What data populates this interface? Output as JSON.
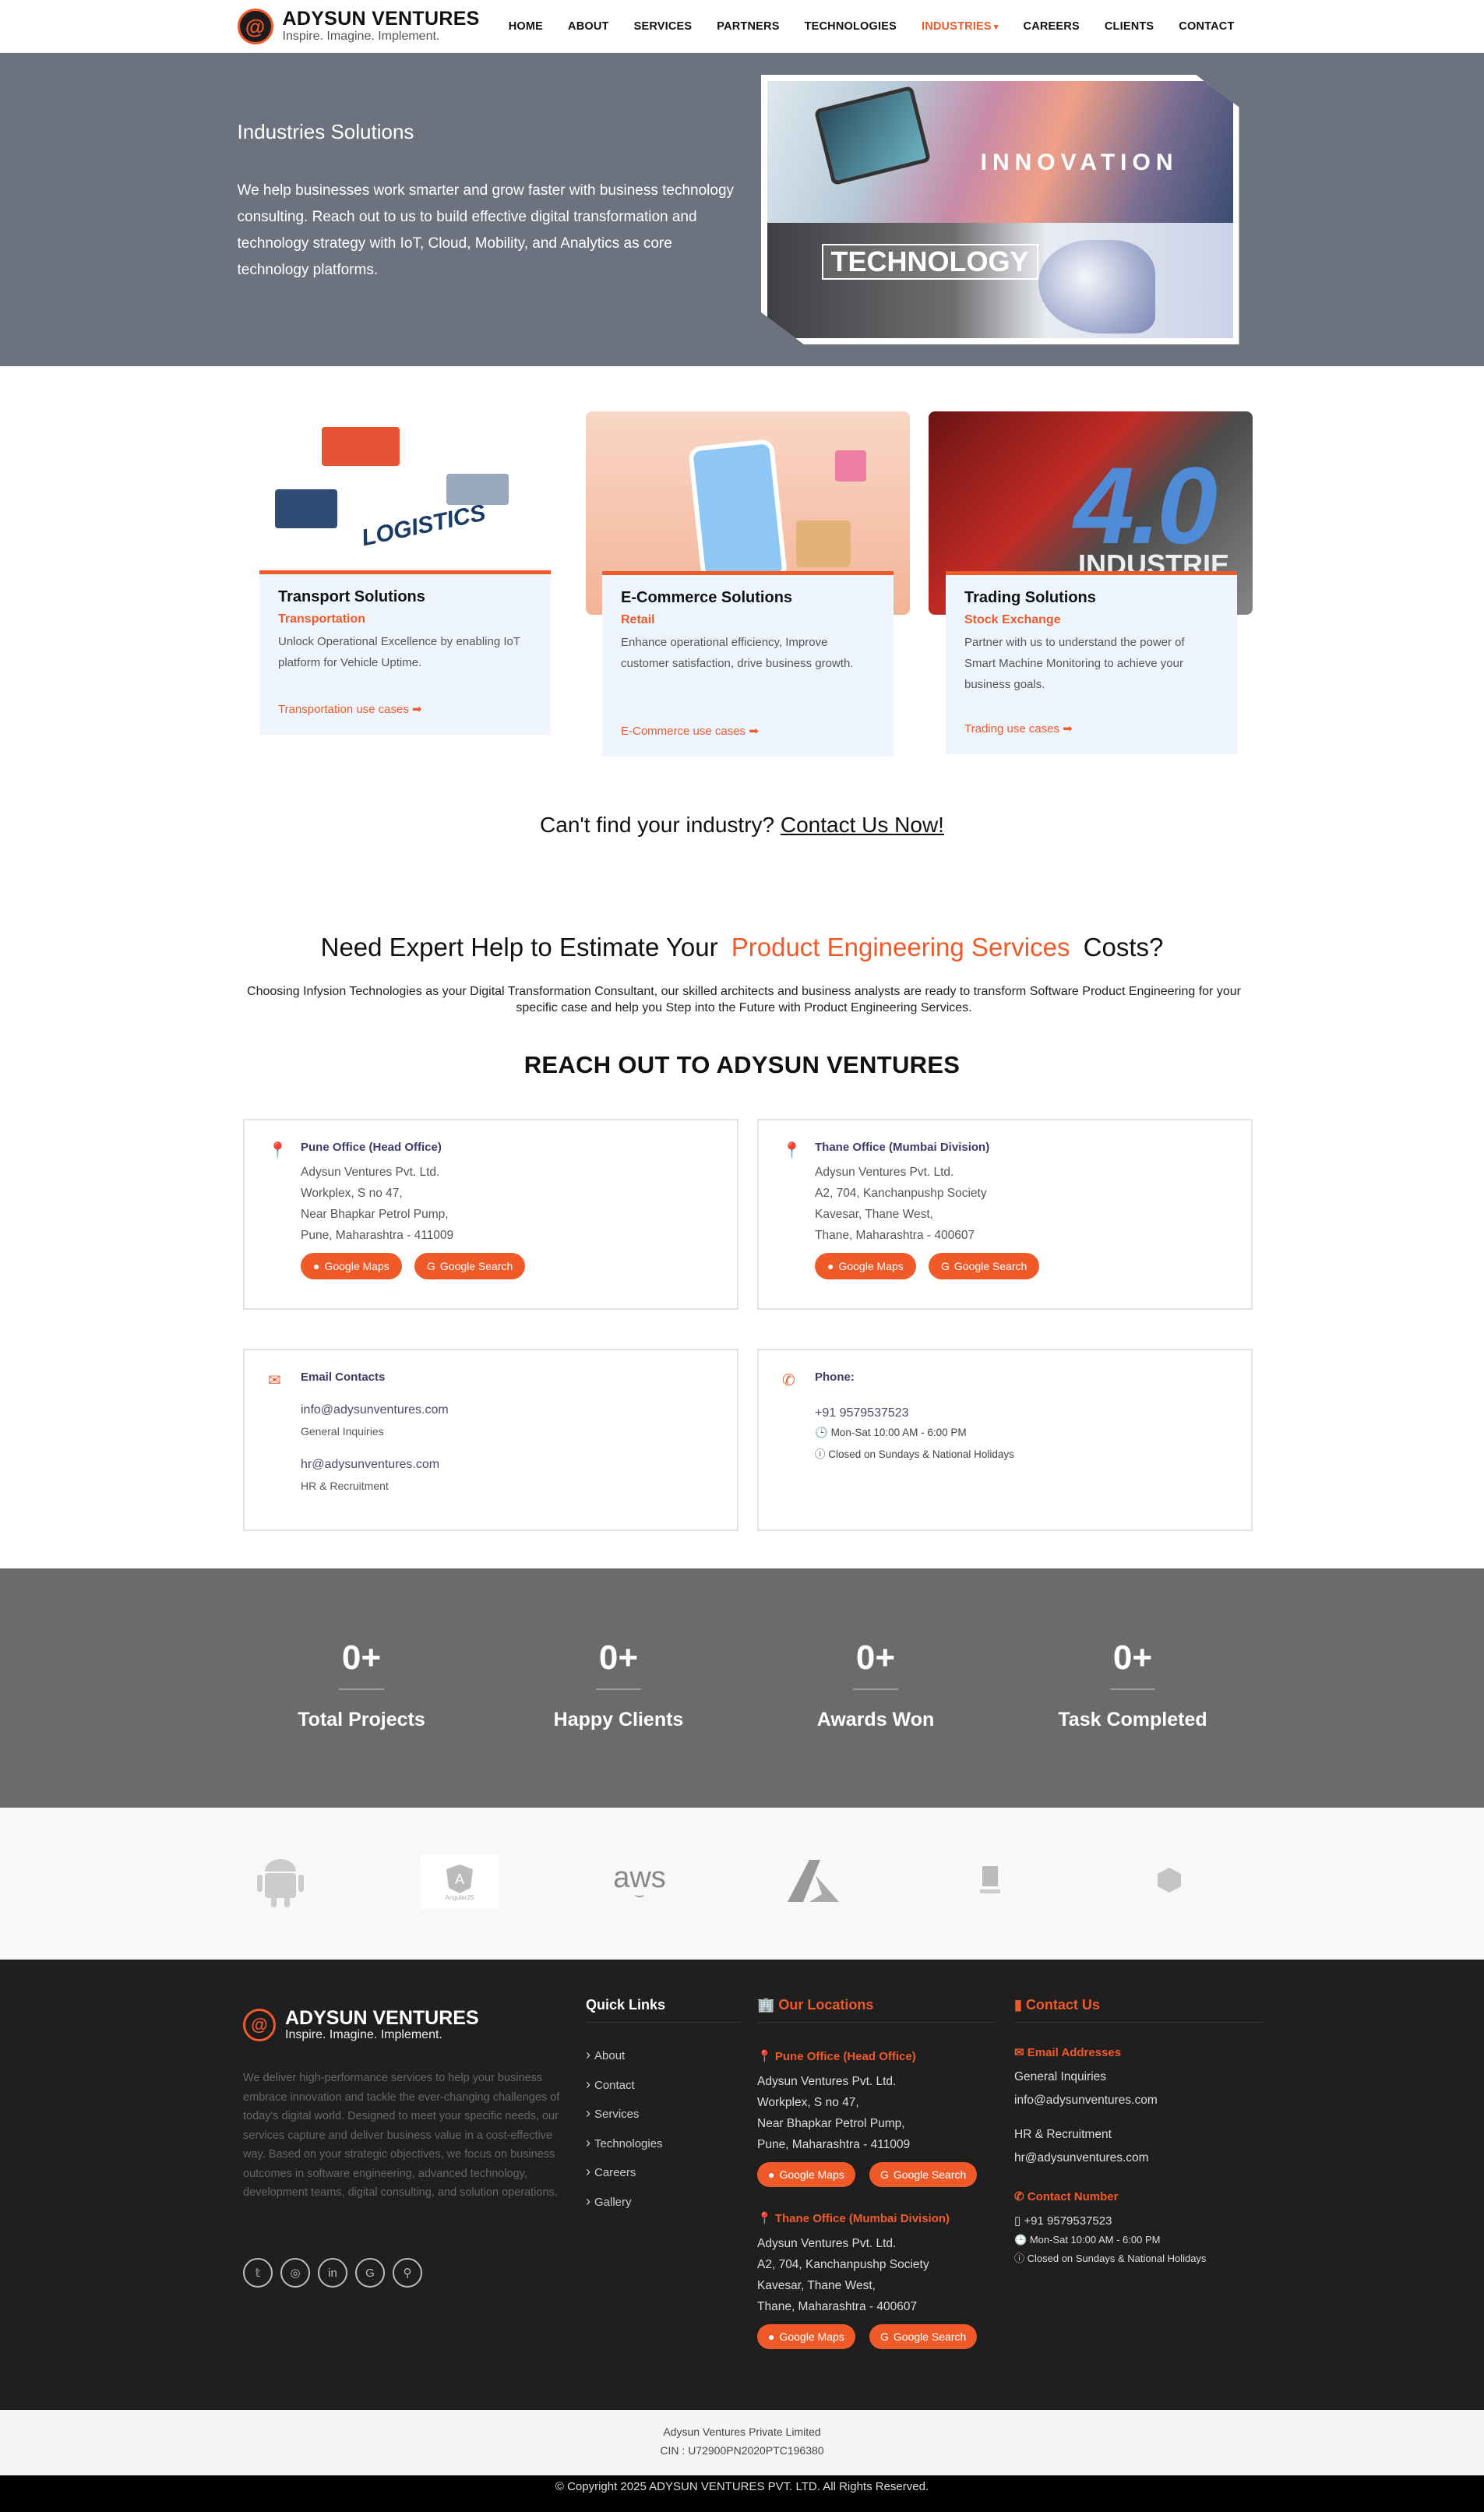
{
  "header": {
    "brand_name": "ADYSUN VENTURES",
    "tagline": "Inspire. Imagine. Implement.",
    "logo_icon": "@",
    "nav": [
      "HOME",
      "ABOUT",
      "SERVICES",
      "PARTNERS",
      "TECHNOLOGIES",
      "INDUSTRIES",
      "CAREERS",
      "CLIENTS",
      "CONTACT"
    ],
    "active_nav": "INDUSTRIES"
  },
  "hero": {
    "title": "Industries Solutions",
    "text": "We help businesses work smarter and grow faster with business technology consulting. Reach out to us to build effective digital transformation and technology strategy with IoT, Cloud, Mobility, and Analytics as core technology platforms.",
    "img_word_1": "INNOVATION",
    "img_word_2": "TECHNOLOGY"
  },
  "industries": [
    {
      "title": "Transport Solutions",
      "sub": "Transportation",
      "desc": "Unlock Operational Excellence by enabling IoT platform for Vehicle Uptime.",
      "link": "Transportation use cases",
      "img_word": "LOGISTICS"
    },
    {
      "title": "E-Commerce Solutions",
      "sub": "Retail",
      "desc": "Enhance operational efficiency, Improve customer satisfaction, drive business growth.",
      "link": "E-Commerce use cases",
      "img_word": ""
    },
    {
      "title": "Trading Solutions",
      "sub": "Stock Exchange",
      "desc": "Partner with us to understand the power of Smart Machine Monitoring to achieve your business goals.",
      "link": "Trading use cases",
      "img_word": "4.0",
      "img_word_2": "INDUSTRIE"
    }
  ],
  "cant_find": {
    "text": "Can't find your industry?",
    "link": "Contact Us Now!"
  },
  "estimate": {
    "title_pre": "Need Expert Help to Estimate Your",
    "title_hl": "Product Engineering Services",
    "title_post": "Costs?",
    "text": "Choosing Infysion Technologies as your Digital Transformation Consultant, our skilled architects and business analysts are ready to transform Software Product Engineering for your specific case and help you Step into the Future with Product Engineering Services."
  },
  "reach": "REACH OUT TO ADYSUN VENTURES",
  "contact": {
    "pune": {
      "title": "Pune Office (Head Office)",
      "lines": [
        "Adysun Ventures Pvt. Ltd.",
        "Workplex, S no 47,",
        "Near Bhapkar Petrol Pump,",
        "Pune, Maharashtra - 411009"
      ]
    },
    "thane": {
      "title": "Thane Office (Mumbai Division)",
      "lines": [
        "Adysun Ventures Pvt. Ltd.",
        "A2, 704, Kanchanpushp Society",
        "Kavesar, Thane West,",
        "Thane, Maharashtra - 400607"
      ]
    },
    "maps_btn": "Google Maps",
    "search_btn": "Google Search",
    "email": {
      "title": "Email Contacts",
      "general": "info@adysunventures.com",
      "general_label": "General Inquiries",
      "hr": "hr@adysunventures.com",
      "hr_label": "HR & Recruitment"
    },
    "phone": {
      "title": "Phone:",
      "number": "+91 9579537523",
      "hours": "Mon-Sat 10:00 AM - 6:00 PM",
      "closed": "Closed on Sundays & National Holidays"
    }
  },
  "stats": [
    {
      "value": "0+",
      "label": "Total Projects"
    },
    {
      "value": "0+",
      "label": "Happy Clients"
    },
    {
      "value": "0+",
      "label": "Awards Won"
    },
    {
      "value": "0+",
      "label": "Task Completed"
    }
  ],
  "tech_logos": [
    "android-icon",
    "angular-icon",
    "aws-icon",
    "azure-icon",
    "logo-5-icon",
    "logo-6-icon"
  ],
  "tech_labels": {
    "aws": "aws",
    "angular": "AngularJS"
  },
  "footer": {
    "brand_name": "ADYSUN VENTURES",
    "tagline": "Inspire. Imagine. Implement.",
    "desc": "We deliver high-performance services to help your business embrace innovation and tackle the ever-changing challenges of today's digital world. Designed to meet your specific needs, our services capture and deliver business value in a cost-effective way. Based on your strategic objectives, we focus on business outcomes in software engineering, advanced technology, development teams, digital consulting, and solution operations.",
    "quick_links_title": "Quick Links",
    "quick_links": [
      "About",
      "Contact",
      "Services",
      "Technologies",
      "Careers",
      "Gallery"
    ],
    "locations_title": "Our Locations",
    "contact_title": "Contact Us",
    "email_title": "Email Addresses",
    "general": "General Inquiries",
    "info_email": "info@adysunventures.com",
    "hr": "HR & Recruitment",
    "hr_email": "hr@adysunventures.com",
    "contact_number_title": "Contact Number",
    "phone": "+91 9579537523",
    "hours": "Mon-Sat 10:00 AM - 6:00 PM",
    "closed": "Closed on Sundays & National Holidays"
  },
  "bottom": {
    "company": "Adysun Ventures Private Limited",
    "cin": "CIN : U72900PN2020PTC196380",
    "copyright": "© Copyright 2025 ADYSUN VENTURES PVT. LTD. All Rights Reserved."
  },
  "colors": {
    "accent": "#f05a28",
    "hero_bg": "#6c737e",
    "stats_bg": "#6b6b6b",
    "footer_bg": "#1f1f1f"
  }
}
